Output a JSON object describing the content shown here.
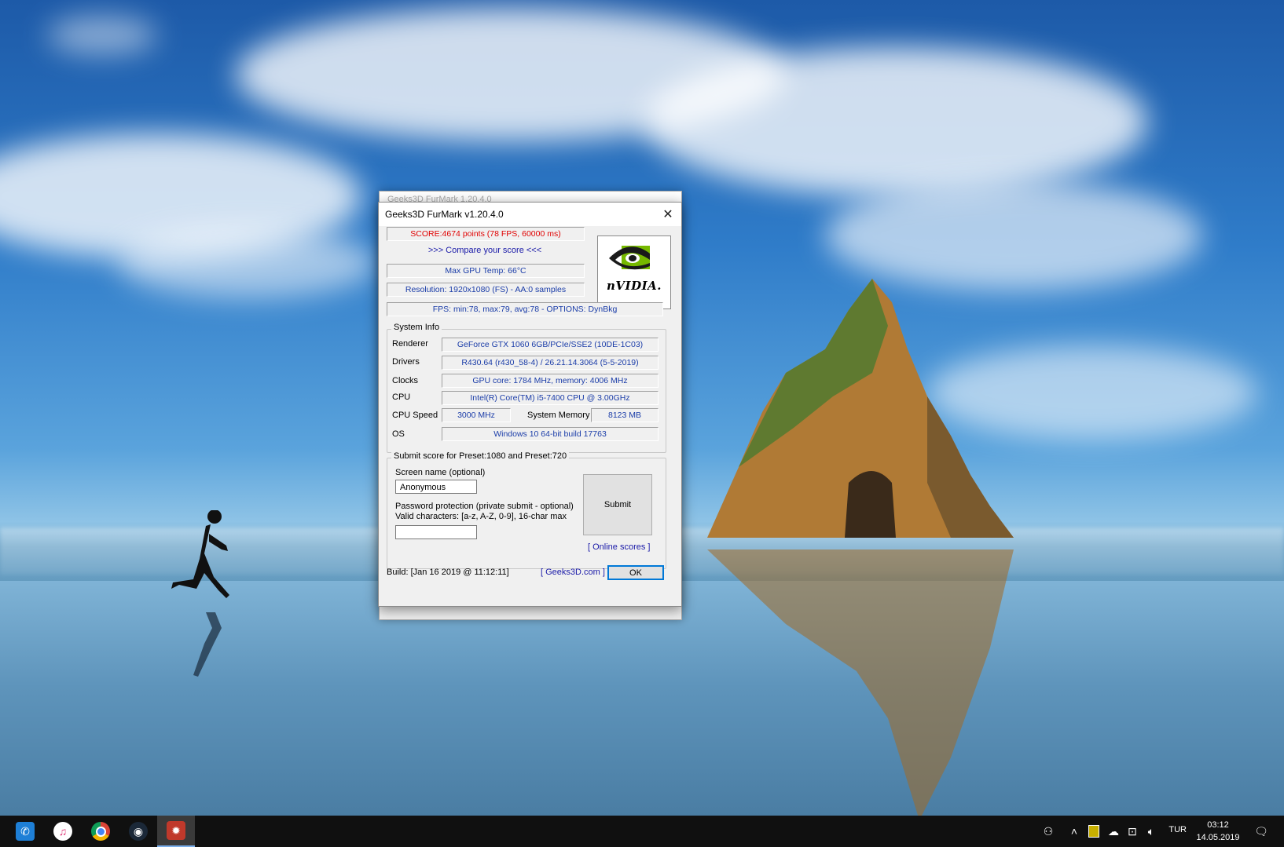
{
  "window": {
    "title": "Geeks3D FurMark v1.20.4.0",
    "ghost_title": "Geeks3D FurMark 1.20.4.0"
  },
  "results": {
    "score": "SCORE:4674 points (78 FPS, 60000 ms)",
    "compare": ">>> Compare your score <<<",
    "max_temp": "Max GPU Temp: 66°C",
    "resolution": "Resolution: 1920x1080 (FS) - AA:0 samples",
    "fps": "FPS: min:78, max:79, avg:78 - OPTIONS: DynBkg"
  },
  "logo": {
    "text": "nVIDIA."
  },
  "system_info": {
    "group_label": "System Info",
    "renderer_label": "Renderer",
    "renderer": "GeForce GTX 1060 6GB/PCIe/SSE2 (10DE-1C03)",
    "drivers_label": "Drivers",
    "drivers": "R430.64 (r430_58-4) / 26.21.14.3064 (5-5-2019)",
    "clocks_label": "Clocks",
    "clocks": "GPU core: 1784 MHz, memory: 4006 MHz",
    "cpu_label": "CPU",
    "cpu": "Intel(R) Core(TM) i5-7400 CPU @ 3.00GHz",
    "cpu_speed_label": "CPU Speed",
    "cpu_speed": "3000 MHz",
    "system_memory_label": "System Memory",
    "system_memory": "8123 MB",
    "os_label": "OS",
    "os": "Windows 10 64-bit build 17763"
  },
  "submit": {
    "group_label": "Submit score for Preset:1080 and Preset:720",
    "screen_name_label": "Screen name (optional)",
    "screen_name_value": "Anonymous",
    "password_label_1": "Password protection (private submit - optional)",
    "password_label_2": "Valid characters: [a-z, A-Z, 0-9], 16-char max",
    "password_value": "",
    "submit_button": "Submit",
    "online_scores": "[ Online scores ]"
  },
  "footer": {
    "build": "Build: [Jan 16 2019 @ 11:12:11]",
    "geeks3d_link": "[ Geeks3D.com ]",
    "ok_button": "OK"
  },
  "taskbar": {
    "apps": [
      {
        "icon": "whatsapp-icon",
        "color": "#1e7fd6"
      },
      {
        "icon": "itunes-icon",
        "color": "#ffffff"
      },
      {
        "icon": "chrome-icon",
        "color": "#dd4b39"
      },
      {
        "icon": "steam-icon",
        "color": "#1b2838"
      },
      {
        "icon": "furmark-icon",
        "color": "#c0392b"
      }
    ],
    "language": "TUR",
    "time": "03:12",
    "date": "14.05.2019"
  }
}
